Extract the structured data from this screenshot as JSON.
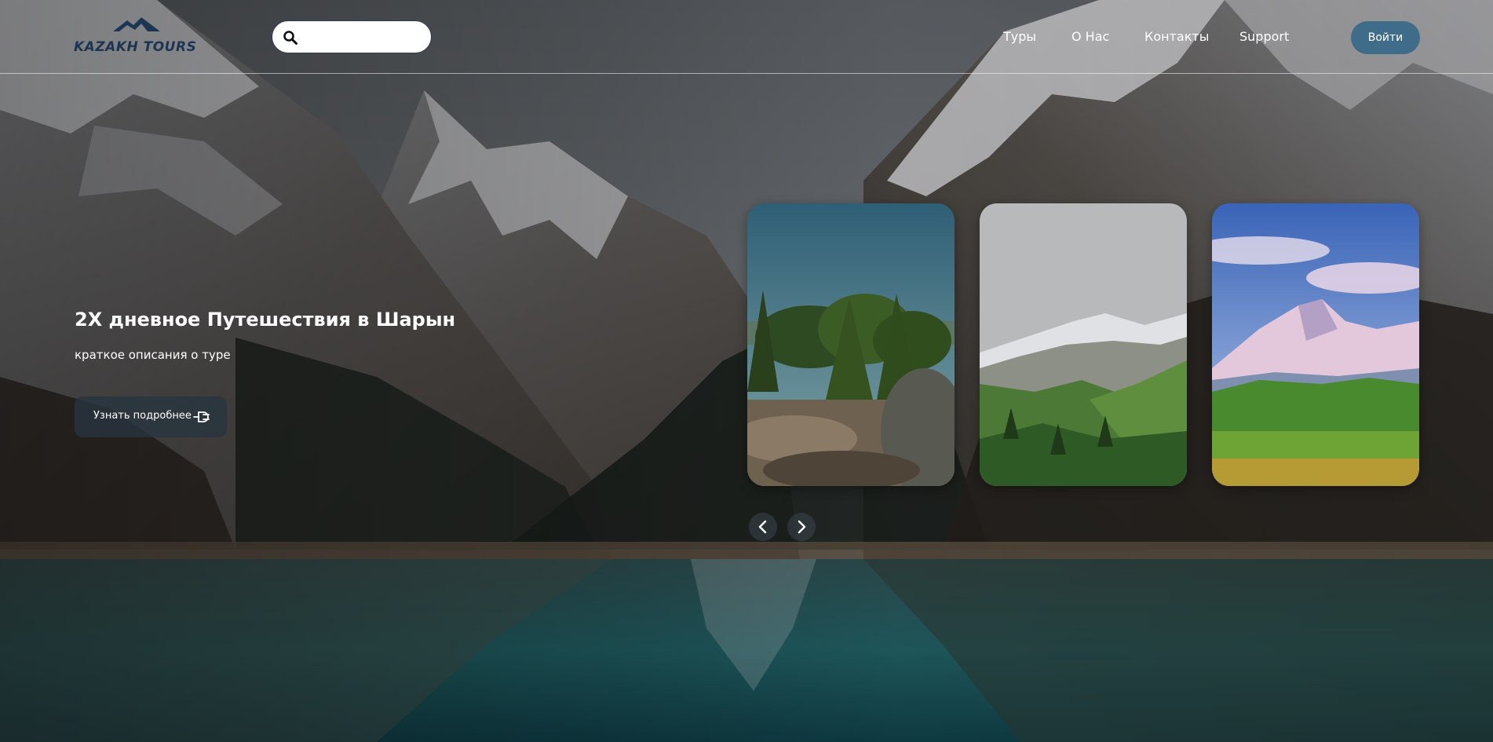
{
  "brand": {
    "name": "KAZAKH TOURS",
    "logo_icon": "mountain-icon",
    "color": "#1c3553"
  },
  "search": {
    "placeholder": "",
    "value": "",
    "icon": "search-icon"
  },
  "nav": {
    "items": [
      {
        "label": "Туры"
      },
      {
        "label": "О Нас"
      },
      {
        "label": "Контакты"
      },
      {
        "label": "Support"
      }
    ],
    "login_label": "Войти",
    "login_color": "#3f6d89"
  },
  "hero": {
    "title": "2Х дневное Путешествия в Шарын",
    "subtitle": "краткое описания о туре",
    "more_label": "Узнать подробнее",
    "more_icon": "plug-icon"
  },
  "carousel": {
    "cards": [
      {
        "scene": "forest-canyon-scene"
      },
      {
        "scene": "green-valley-scene"
      },
      {
        "scene": "snow-peak-scene"
      }
    ],
    "prev_icon": "chevron-left-icon",
    "next_icon": "chevron-right-icon"
  }
}
